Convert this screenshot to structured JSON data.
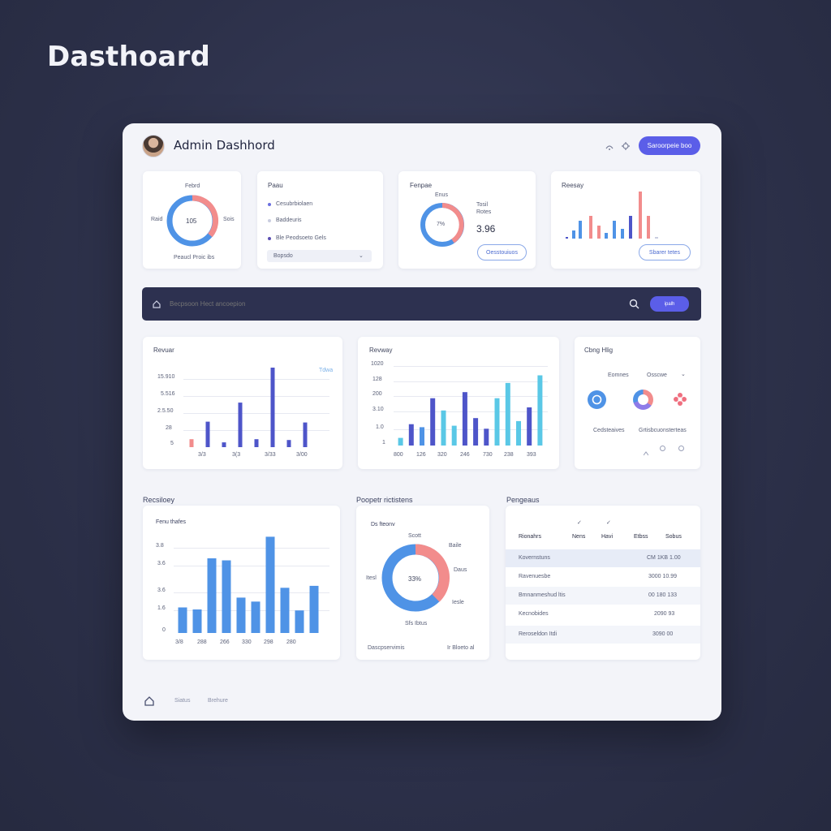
{
  "page_title": "Dasthoard",
  "header": {
    "title": "Admin Dashhord",
    "primary_button": "Saroorpeie boo"
  },
  "cards_top": {
    "card1": {
      "title": "Febrd",
      "center": "105",
      "left": "Raid",
      "right": "Sois",
      "footer": "Peaucl Proic ibs"
    },
    "card2": {
      "title": "Paau",
      "items": [
        {
          "label": "Cesubrbiolaen",
          "color": "#6b6fe0"
        },
        {
          "label": "Baddeuris",
          "color": "#c9cde0"
        },
        {
          "label": "Ble Peodsoeto Gels",
          "color": "#5b4fb3"
        }
      ],
      "select_value": "Bopsdo"
    },
    "card3": {
      "title": "Fenpae",
      "top": "Enus",
      "center": "7%",
      "right_small1": "Tosil",
      "right_small2": "Rotes",
      "value": "3.96",
      "button": "Oesstouiuos"
    },
    "card4": {
      "title": "Reesay",
      "button": "Sbarer tetes"
    }
  },
  "searchbar": {
    "placeholder": "Becpsoon Hect ancoepion",
    "button": "ipalh"
  },
  "revenue_chart": {
    "title": "Revuar",
    "legend": "Tdwa",
    "y_ticks": [
      "15.910",
      "5.516",
      "2.5.50",
      "28",
      "5"
    ],
    "x_ticks": [
      "3/3",
      "3(3",
      "3/33",
      "3/00"
    ]
  },
  "revway_chart": {
    "title": "Revway",
    "y_ticks": [
      "1020",
      "128",
      "200",
      "3.10",
      "1.0",
      "1"
    ],
    "x_ticks": [
      "800",
      "126",
      "320",
      "246",
      "730",
      "238",
      "393"
    ]
  },
  "config_card": {
    "title": "Cbng Hlig",
    "tab1": "Eomnes",
    "tab2": "Osscwe",
    "caption1": "Cedsteaives",
    "caption2": "Grtisbcuonsterteas"
  },
  "recent_chart": {
    "section": "Recsiloey",
    "title": "Fenu thafes",
    "y_ticks": [
      "3.8",
      "3.6",
      "3.6",
      "1.6",
      "0"
    ],
    "x_ticks": [
      "3/8",
      "288",
      "266",
      "330",
      "298",
      "280"
    ]
  },
  "donut_big": {
    "section": "Poopetr rictistens",
    "title": "Ds fteonv",
    "center": "33%",
    "top": "Scott",
    "right1": "Baile",
    "right2": "Daus",
    "left": "Itesl",
    "right3": "Iesle",
    "bottom": "Sfs Ibtus",
    "footer_left": "Dascpservimis",
    "footer_right": "Ir Bloeto al"
  },
  "table": {
    "section": "Pengeaus",
    "columns": [
      "Rionahrs",
      "Nens",
      "Havi",
      "Etbss",
      "Sobus"
    ],
    "rows": [
      {
        "name": "Kovernstuns",
        "value": "CM 1KB 1.00"
      },
      {
        "name": "Ravenuesbe",
        "value": "3000 10.99"
      },
      {
        "name": "Bmnanmeshud ltis",
        "value": "00 180 133"
      },
      {
        "name": "Kecnobides",
        "value": "2090 93"
      },
      {
        "name": "Reroseldon Itdi",
        "value": "3090 00"
      }
    ]
  },
  "footer": {
    "item1": "Siatus",
    "item2": "Brehure"
  },
  "chart_data": [
    {
      "type": "bar",
      "title": "Revuar",
      "categories": [
        "1",
        "2",
        "3",
        "4",
        "5",
        "6",
        "7",
        "8"
      ],
      "series": [
        {
          "values": [
            10,
            32,
            6,
            56,
            10,
            100,
            9,
            31
          ]
        }
      ],
      "ylim": [
        0,
        100
      ]
    },
    {
      "type": "bar",
      "title": "Revway",
      "categories": [
        "1",
        "2",
        "3",
        "4",
        "5",
        "6",
        "7",
        "8",
        "9",
        "10",
        "11",
        "12",
        "13",
        "14"
      ],
      "series": [
        {
          "values": [
            10,
            28,
            24,
            62,
            46,
            26,
            70,
            36,
            22,
            62,
            82,
            32,
            50,
            92
          ]
        }
      ],
      "ylim": [
        0,
        100
      ]
    },
    {
      "type": "bar",
      "title": "Fenu thafes",
      "categories": [
        "1",
        "2",
        "3",
        "4",
        "5",
        "6",
        "7",
        "8",
        "9",
        "10"
      ],
      "series": [
        {
          "values": [
            26,
            24,
            76,
            74,
            36,
            32,
            98,
            46,
            23,
            48
          ]
        }
      ],
      "ylim": [
        0,
        100
      ]
    }
  ],
  "colors": {
    "accent": "#5b5ee8",
    "blue": "#4f93e6",
    "salmon": "#f28c8c",
    "indigo": "#4e55c9",
    "cyan": "#5ac8e6",
    "dark": "#2d3150"
  }
}
